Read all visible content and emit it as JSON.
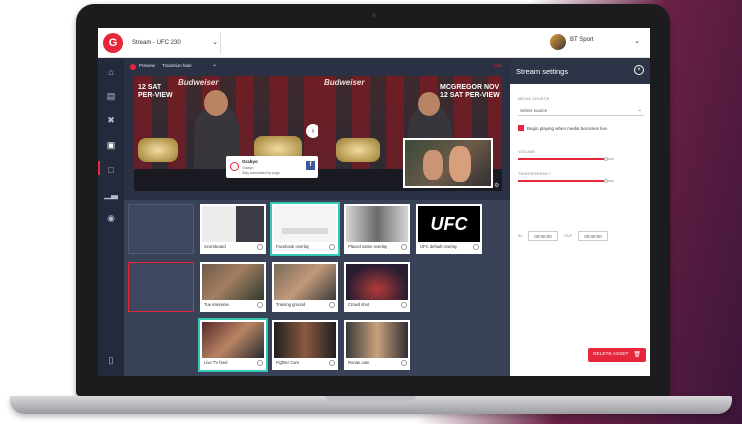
{
  "app": {
    "stream_name": "Stream - UFC 230",
    "account_name": "BT Sport",
    "logo_letter": "G",
    "accent_color": "#e5263b",
    "selected_color": "#36c9b6"
  },
  "nav": {
    "icons": [
      "home-icon",
      "media-icon",
      "tools-icon",
      "stream-icon",
      "folder-icon",
      "analytics-icon",
      "users-icon",
      "chat-icon"
    ]
  },
  "preview": {
    "preview_label": "Preview",
    "transition_label": "Transition fade",
    "live_label": "Live",
    "left_sign": "12 SAT\nPER-VIEW",
    "right_sign": "MCGREGOR\nNOV 12 SAT\nPER-VIEW",
    "brand_text": "Budweiser",
    "popup": {
      "title": "Grabyo",
      "line1": "Grabyo",
      "line2": "Stay automated by page"
    }
  },
  "sources": {
    "tiles": [
      {
        "label": "Scoreboard"
      },
      {
        "label": "Facebook overlay"
      },
      {
        "label": "Placed name overlay"
      },
      {
        "label": "UFC default overlay"
      },
      {
        "label": "Tue interview"
      },
      {
        "label": "Training ground"
      },
      {
        "label": "Crowd shot"
      },
      {
        "label": "Live TV feed"
      },
      {
        "label": "Fighter Cam"
      },
      {
        "label": "Ronan cam"
      }
    ],
    "ufc_logo": "UFC"
  },
  "panel": {
    "title": "Stream settings",
    "media_source_label": "MEDIA SOURCE",
    "media_source_value": "Select source",
    "autoplay_label": "Begin playing when media becomes live",
    "volume_label": "VOLUME",
    "volume_level": 0.92,
    "transparency_label": "TRANSPARENCY",
    "transparency_level": 0.92,
    "in_label": "IN",
    "in_value": "00:00:00",
    "out_label": "OUT",
    "out_value": "00:00:00",
    "delete_label": "DELETE ASSET"
  }
}
